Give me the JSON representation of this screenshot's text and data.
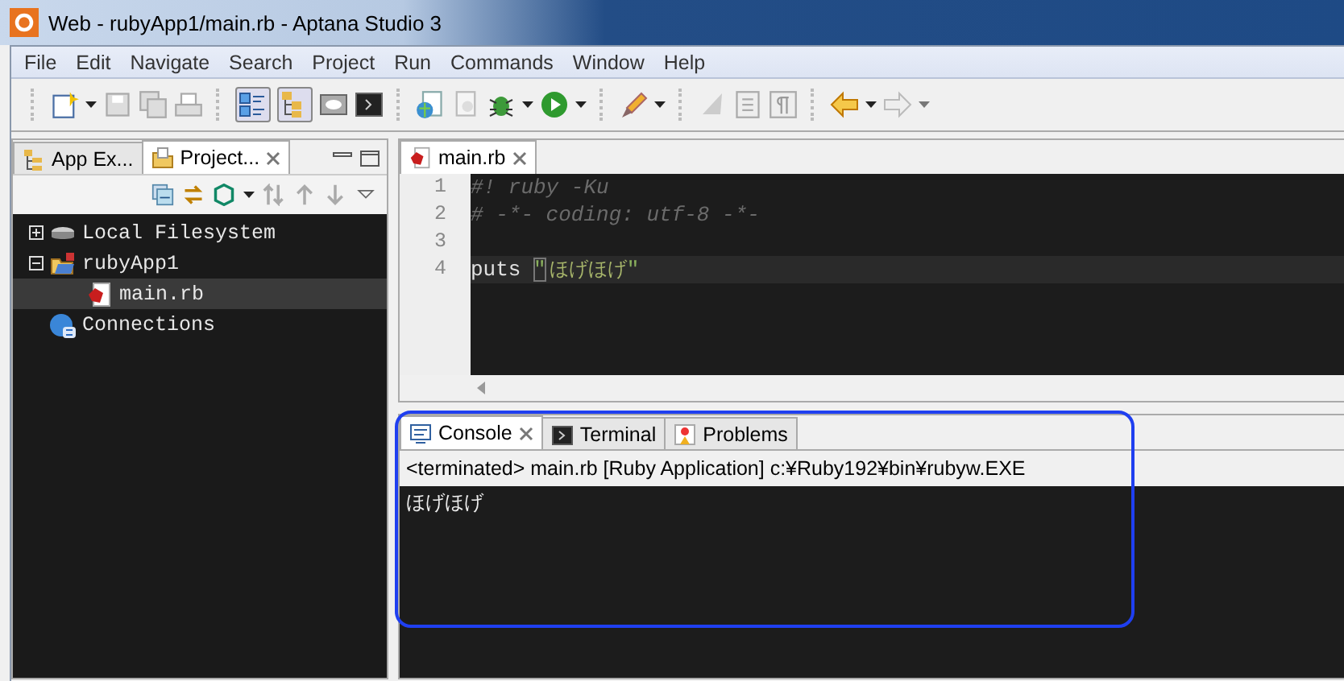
{
  "window": {
    "title": "Web - rubyApp1/main.rb - Aptana Studio 3"
  },
  "menu": [
    "File",
    "Edit",
    "Navigate",
    "Search",
    "Project",
    "Run",
    "Commands",
    "Window",
    "Help"
  ],
  "left_tabs": [
    {
      "label": "App Ex...",
      "selected": false,
      "kind": "explorer"
    },
    {
      "label": "Project...",
      "selected": true,
      "kind": "project"
    }
  ],
  "tree": [
    {
      "label": "Local Filesystem",
      "kind": "drive",
      "expanded": false,
      "selected": false
    },
    {
      "label": "rubyApp1",
      "kind": "project",
      "expanded": true,
      "selected": false,
      "children": [
        {
          "label": "main.rb",
          "kind": "file",
          "selected": true
        }
      ]
    },
    {
      "label": "Connections",
      "kind": "connections",
      "selected": false
    }
  ],
  "editor": {
    "tab": "main.rb",
    "lines": [
      {
        "number": "1",
        "current": false,
        "tokens": [
          {
            "kind": "comment",
            "text": "#! ruby -Ku"
          }
        ]
      },
      {
        "number": "2",
        "current": false,
        "tokens": [
          {
            "kind": "comment",
            "text": "# -*- coding: utf-8 -*-"
          }
        ]
      },
      {
        "number": "3",
        "current": false
      },
      {
        "number": "4",
        "current": true,
        "tokens": [
          {
            "kind": "plain",
            "text": "puts "
          },
          {
            "kind": "matched_quote",
            "text": "\""
          },
          {
            "kind": "string",
            "text": "ほげほげ"
          },
          {
            "kind": "quote",
            "text": "\""
          }
        ]
      }
    ]
  },
  "console": {
    "tabs": [
      {
        "label": "Console",
        "selected": true,
        "kind": "console"
      },
      {
        "label": "Terminal",
        "selected": false,
        "kind": "terminal"
      },
      {
        "label": "Problems",
        "selected": false,
        "kind": "problems"
      }
    ],
    "status": "<terminated> main.rb [Ruby Application] c:¥Ruby192¥bin¥rubyw.EXE",
    "output": [
      "ほげほげ"
    ]
  }
}
